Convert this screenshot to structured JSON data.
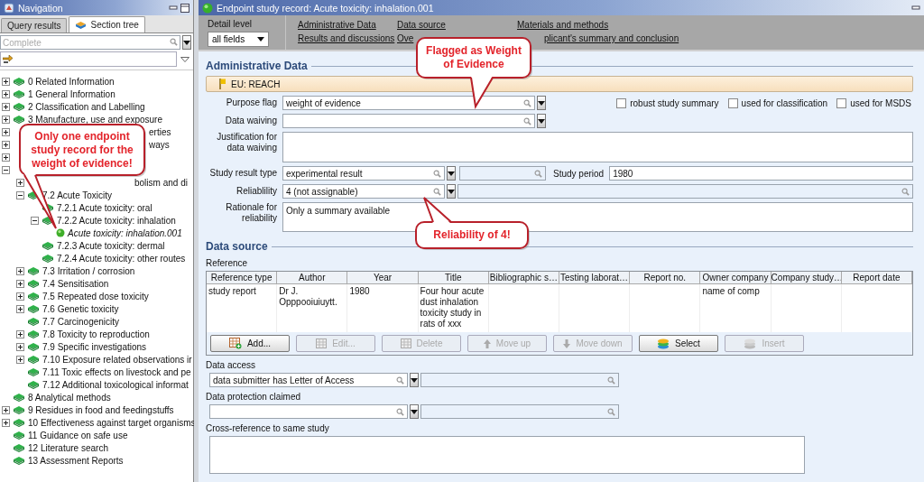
{
  "navigation": {
    "title": "Navigation",
    "tabs": [
      {
        "label": "Query results",
        "selected": false
      },
      {
        "label": "Section tree",
        "selected": true
      }
    ],
    "search": {
      "placeholder": "Complete"
    },
    "tree": [
      {
        "label": "0 Related Information",
        "kind": "branch",
        "expanded": false,
        "covered": false
      },
      {
        "label": "1 General Information",
        "kind": "branch",
        "expanded": false,
        "covered": false
      },
      {
        "label": "2 Classification and Labelling",
        "kind": "branch",
        "expanded": false,
        "covered": false
      },
      {
        "label": "3 Manufacture, use and exposure",
        "kind": "branch",
        "expanded": false,
        "covered": false
      },
      {
        "label": "erties",
        "kind": "branch",
        "expanded": false,
        "covered": true
      },
      {
        "label": "ways",
        "kind": "branch",
        "expanded": false,
        "covered": true
      },
      {
        "kind": "branch",
        "expanded": false,
        "covered": true
      },
      {
        "kind": "branch",
        "expanded": true,
        "covered": true,
        "children": [
          {
            "label": "bolism and di",
            "kind": "branch",
            "expanded": false,
            "covered": true
          },
          {
            "label": "7.2 Acute Toxicity",
            "kind": "branch",
            "expanded": true,
            "covered": false,
            "children": [
              {
                "label": "7.2.1 Acute toxicity: oral",
                "kind": "leaf",
                "covered": false
              },
              {
                "label": "7.2.2 Acute toxicity: inhalation",
                "kind": "branch",
                "expanded": true,
                "covered": false,
                "children": [
                  {
                    "label": "Acute toxicity: inhalation.001",
                    "kind": "record",
                    "covered": false
                  }
                ]
              },
              {
                "label": "7.2.3 Acute toxicity: dermal",
                "kind": "leaf",
                "covered": false
              },
              {
                "label": "7.2.4 Acute toxicity: other routes",
                "kind": "leaf",
                "covered": false
              }
            ]
          },
          {
            "label": "7.3 Irritation / corrosion",
            "kind": "branch",
            "expanded": false,
            "covered": false
          },
          {
            "label": "7.4 Sensitisation",
            "kind": "branch",
            "expanded": false,
            "covered": false
          },
          {
            "label": "7.5 Repeated dose toxicity",
            "kind": "branch",
            "expanded": false,
            "covered": false
          },
          {
            "label": "7.6 Genetic toxicity",
            "kind": "branch",
            "expanded": false,
            "covered": false
          },
          {
            "label": "7.7 Carcinogenicity",
            "kind": "leaf",
            "covered": false
          },
          {
            "label": "7.8 Toxicity to reproduction",
            "kind": "branch",
            "expanded": false,
            "covered": false
          },
          {
            "label": "7.9 Specific investigations",
            "kind": "branch",
            "expanded": false,
            "covered": false
          },
          {
            "label": "7.10 Exposure related observations ir",
            "kind": "branch",
            "expanded": false,
            "covered": false
          },
          {
            "label": "7.11 Toxic effects on livestock and pe",
            "kind": "leaf",
            "covered": false
          },
          {
            "label": "7.12 Additional toxicological informat",
            "kind": "leaf",
            "covered": false
          }
        ]
      },
      {
        "label": "8 Analytical methods",
        "kind": "leaf",
        "covered": false
      },
      {
        "label": "9 Residues in food and feedingstuffs",
        "kind": "branch",
        "expanded": false,
        "covered": false
      },
      {
        "label": "10 Effectiveness against target organisms",
        "kind": "branch",
        "expanded": false,
        "covered": false
      },
      {
        "label": "11 Guidance on safe use",
        "kind": "leaf",
        "covered": false
      },
      {
        "label": "12 Literature search",
        "kind": "leaf",
        "covered": false
      },
      {
        "label": "13 Assessment Reports",
        "kind": "leaf",
        "covered": false
      }
    ]
  },
  "record": {
    "title": "Endpoint study record: Acute toxicity: inhalation.001",
    "detail_level": {
      "label": "Detail level",
      "value": "all fields"
    },
    "links": [
      {
        "label": "Administrative Data"
      },
      {
        "label": "Data source"
      },
      {
        "label": "Materials and methods"
      },
      {
        "label": "Results and discussions"
      },
      {
        "label": "Ove"
      },
      {
        "label": "plicant's summary and conclusion"
      }
    ]
  },
  "administrative_data": {
    "heading": "Administrative Data",
    "programme": "EU: REACH",
    "purpose_flag": {
      "label": "Purpose flag",
      "value": "weight of evidence"
    },
    "checkboxes": [
      {
        "label": "robust study summary",
        "checked": false
      },
      {
        "label": "used for classification",
        "checked": false
      },
      {
        "label": "used for MSDS",
        "checked": false
      }
    ],
    "data_waiving": {
      "label": "Data waiving"
    },
    "justification": {
      "label": "Justification for data waiving"
    },
    "study_result_type": {
      "label": "Study result type",
      "value": "experimental result"
    },
    "study_period": {
      "label": "Study period",
      "value": "1980"
    },
    "reliability": {
      "label": "Reliablility",
      "value": "4 (not assignable)"
    },
    "rationale": {
      "label": "Rationale for reliability",
      "value": "Only a summary available"
    }
  },
  "data_source": {
    "heading": "Data source",
    "reference_label": "Reference",
    "columns": [
      "Reference type",
      "Author",
      "Year",
      "Title",
      "Bibliographic s…",
      "Testing laborat…",
      "Report no.",
      "Owner company",
      "Company study…",
      "Report date"
    ],
    "rows": [
      [
        "study report",
        "Dr J. Opppooiuiuytt.",
        "1980",
        "Four hour acute dust inhalation toxicity study in rats of xxx",
        "",
        "",
        "",
        "name of comp",
        "",
        ""
      ]
    ],
    "buttons": [
      {
        "label": "Add...",
        "kind": "add",
        "disabled": false
      },
      {
        "label": "Edit...",
        "kind": "edit",
        "disabled": true
      },
      {
        "label": "Delete",
        "kind": "delete",
        "disabled": true
      },
      {
        "label": "Move up",
        "kind": "move_up",
        "disabled": true
      },
      {
        "label": "Move down",
        "kind": "move_down",
        "disabled": true
      },
      {
        "label": "Select",
        "kind": "select",
        "disabled": false
      },
      {
        "label": "Insert",
        "kind": "insert",
        "disabled": true
      }
    ],
    "data_access": {
      "label": "Data access",
      "value": "data submitter has Letter of Access"
    },
    "data_protection": {
      "label": "Data protection claimed"
    },
    "cross_reference": {
      "label": "Cross-reference to same study"
    }
  },
  "callouts": [
    {
      "text": "Only one endpoint study record for the weight of evidence!"
    },
    {
      "text": "Flagged as Weight of Evidence"
    },
    {
      "text": "Reliability of 4!"
    }
  ]
}
